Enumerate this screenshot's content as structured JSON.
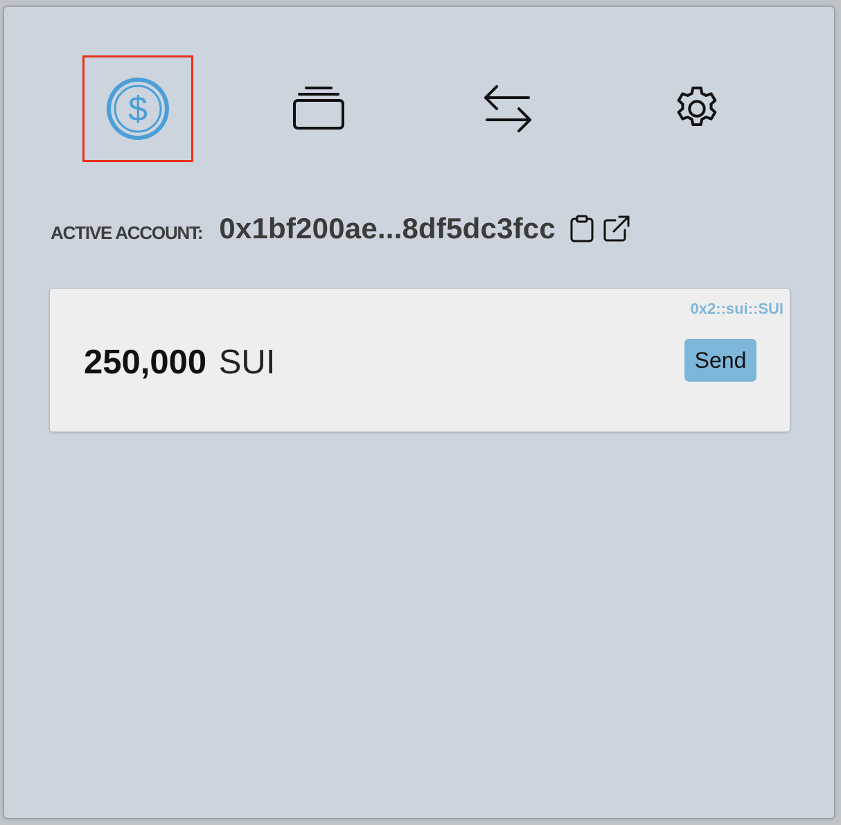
{
  "nav": {
    "items": [
      {
        "name": "coins",
        "icon": "dollar-coin-icon",
        "selected": true
      },
      {
        "name": "nfts",
        "icon": "stacked-cards-icon",
        "selected": false
      },
      {
        "name": "transactions",
        "icon": "swap-arrows-icon",
        "selected": false
      },
      {
        "name": "settings",
        "icon": "gear-icon",
        "selected": false
      }
    ],
    "selected_color": "#4a9fd8",
    "highlight_color": "#e8321c"
  },
  "account": {
    "label": "ACTIVE ACCOUNT:",
    "address": "0x1bf200ae...8df5dc3fcc",
    "copy_icon": "clipboard-icon",
    "explorer_icon": "external-link-icon"
  },
  "coins": [
    {
      "type": "0x2::sui::SUI",
      "amount": "250,000",
      "symbol": "SUI",
      "send_label": "Send"
    }
  ],
  "colors": {
    "background": "#ccd4dd",
    "card": "#eeeeee",
    "send_button": "#7db6d8",
    "coin_type": "#80b8d9"
  }
}
